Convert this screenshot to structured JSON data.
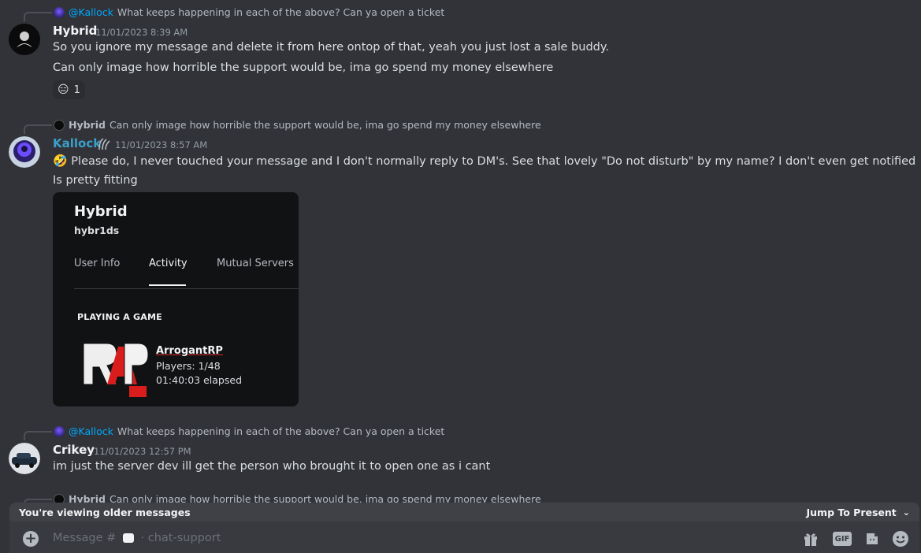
{
  "messages": [
    {
      "reply": {
        "mention": "@Kallock",
        "text": "What keeps happening in each of the above? Can ya open a ticket"
      },
      "author": "Hybrid",
      "timestamp": "11/01/2023 8:39 AM",
      "lines": [
        "So you ignore my message and delete it from here ontop of that, yeah you just lost a sale buddy.",
        "Can only image how horrible the support would be, ima go spend my money elsewhere"
      ],
      "reaction": {
        "emoji": "😑",
        "count": "1"
      }
    },
    {
      "reply": {
        "name": "Hybrid",
        "text": "Can only image how horrible the support would be, ima go spend my money elsewhere"
      },
      "author": "Kallock",
      "author_color": "#3ba0c9",
      "timestamp": "11/01/2023 8:57 AM",
      "lines": [
        "Please do, I never touched your message and I don't normally reply to DM's. See that lovely \"Do not disturb\" by my name? I don't even get notified",
        "Is pretty fitting"
      ],
      "emoji": "🤣",
      "profile_card": {
        "name": "Hybrid",
        "handle": "hybr1ds",
        "tabs": [
          "User Info",
          "Activity",
          "Mutual Servers"
        ],
        "active_tab": "Activity",
        "section": "PLAYING A GAME",
        "game": "ArrogantRP",
        "players": "Players: 1/48",
        "elapsed": "01:40:03 elapsed"
      }
    },
    {
      "reply": {
        "mention": "@Kallock",
        "text": "What keeps happening in each of the above? Can ya open a ticket"
      },
      "author": "Crikey",
      "timestamp": "11/01/2023 12:57 PM",
      "lines": [
        "im just the server dev ill get the person who brought it to open one as i cant"
      ]
    },
    {
      "reply": {
        "name": "Hybrid",
        "text": "Can only image how horrible the support would be, ima go spend my money elsewhere"
      }
    }
  ],
  "older_bar": {
    "text": "You're viewing older messages",
    "jump": "Jump To Present"
  },
  "composer": {
    "placeholder_prefix": "Message #",
    "channel": "· chat-support",
    "gif": "GIF"
  },
  "colors": {
    "background": "#313338",
    "mention": "#00a8fc",
    "kallock": "#3ba0c9"
  }
}
